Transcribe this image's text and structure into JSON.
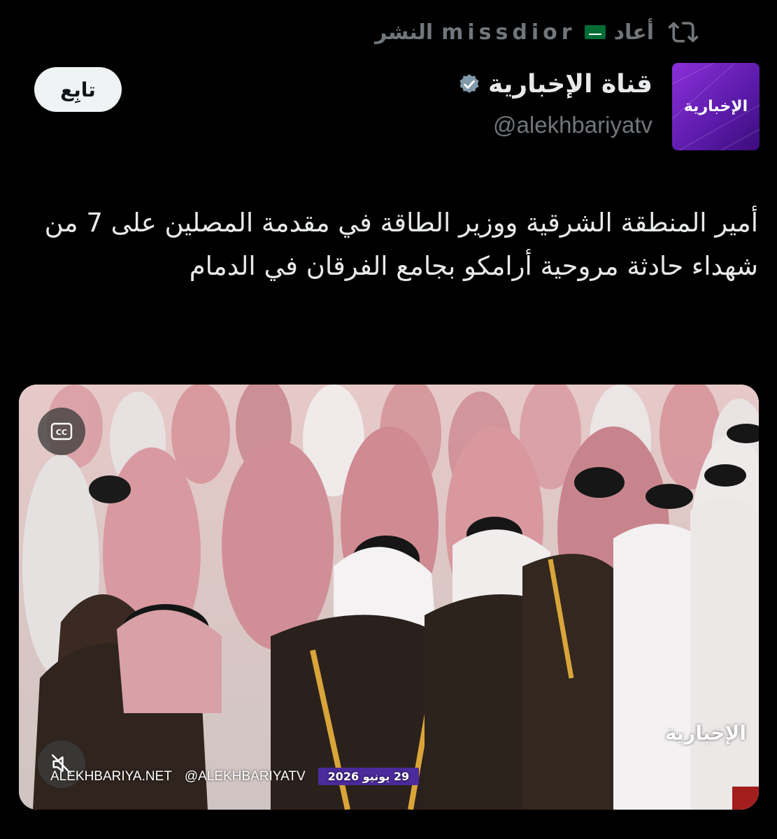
{
  "repost": {
    "label": "أعاد",
    "user": "missdior",
    "suffix": "النشر",
    "icon": "repost-icon"
  },
  "account": {
    "display_name": "قناة الإخبارية",
    "handle": "@alekhbariyatv",
    "avatar_text": "الإخبارية",
    "verified": true
  },
  "follow_label": "تابِع",
  "tweet": {
    "text": "أمير المنطقة الشرقية ووزير الطاقة في مقدمة المصلين على 7 من شهداء حادثة مروحية أرامكو بجامع الفرقان في الدمام"
  },
  "media": {
    "watermark": "الإخبارية",
    "site": "ALEKHBARIYA.NET",
    "handle": "@ALEKHBARIYATV",
    "date": "29 يونيو 2026",
    "cc_icon": "closed-captions-icon",
    "mute_icon": "muted-speaker-icon"
  },
  "colors": {
    "background": "#000000",
    "text": "#e7e9ea",
    "muted": "#71767b",
    "avatar": "#6b22c0",
    "badge": "#4b2a9b"
  }
}
